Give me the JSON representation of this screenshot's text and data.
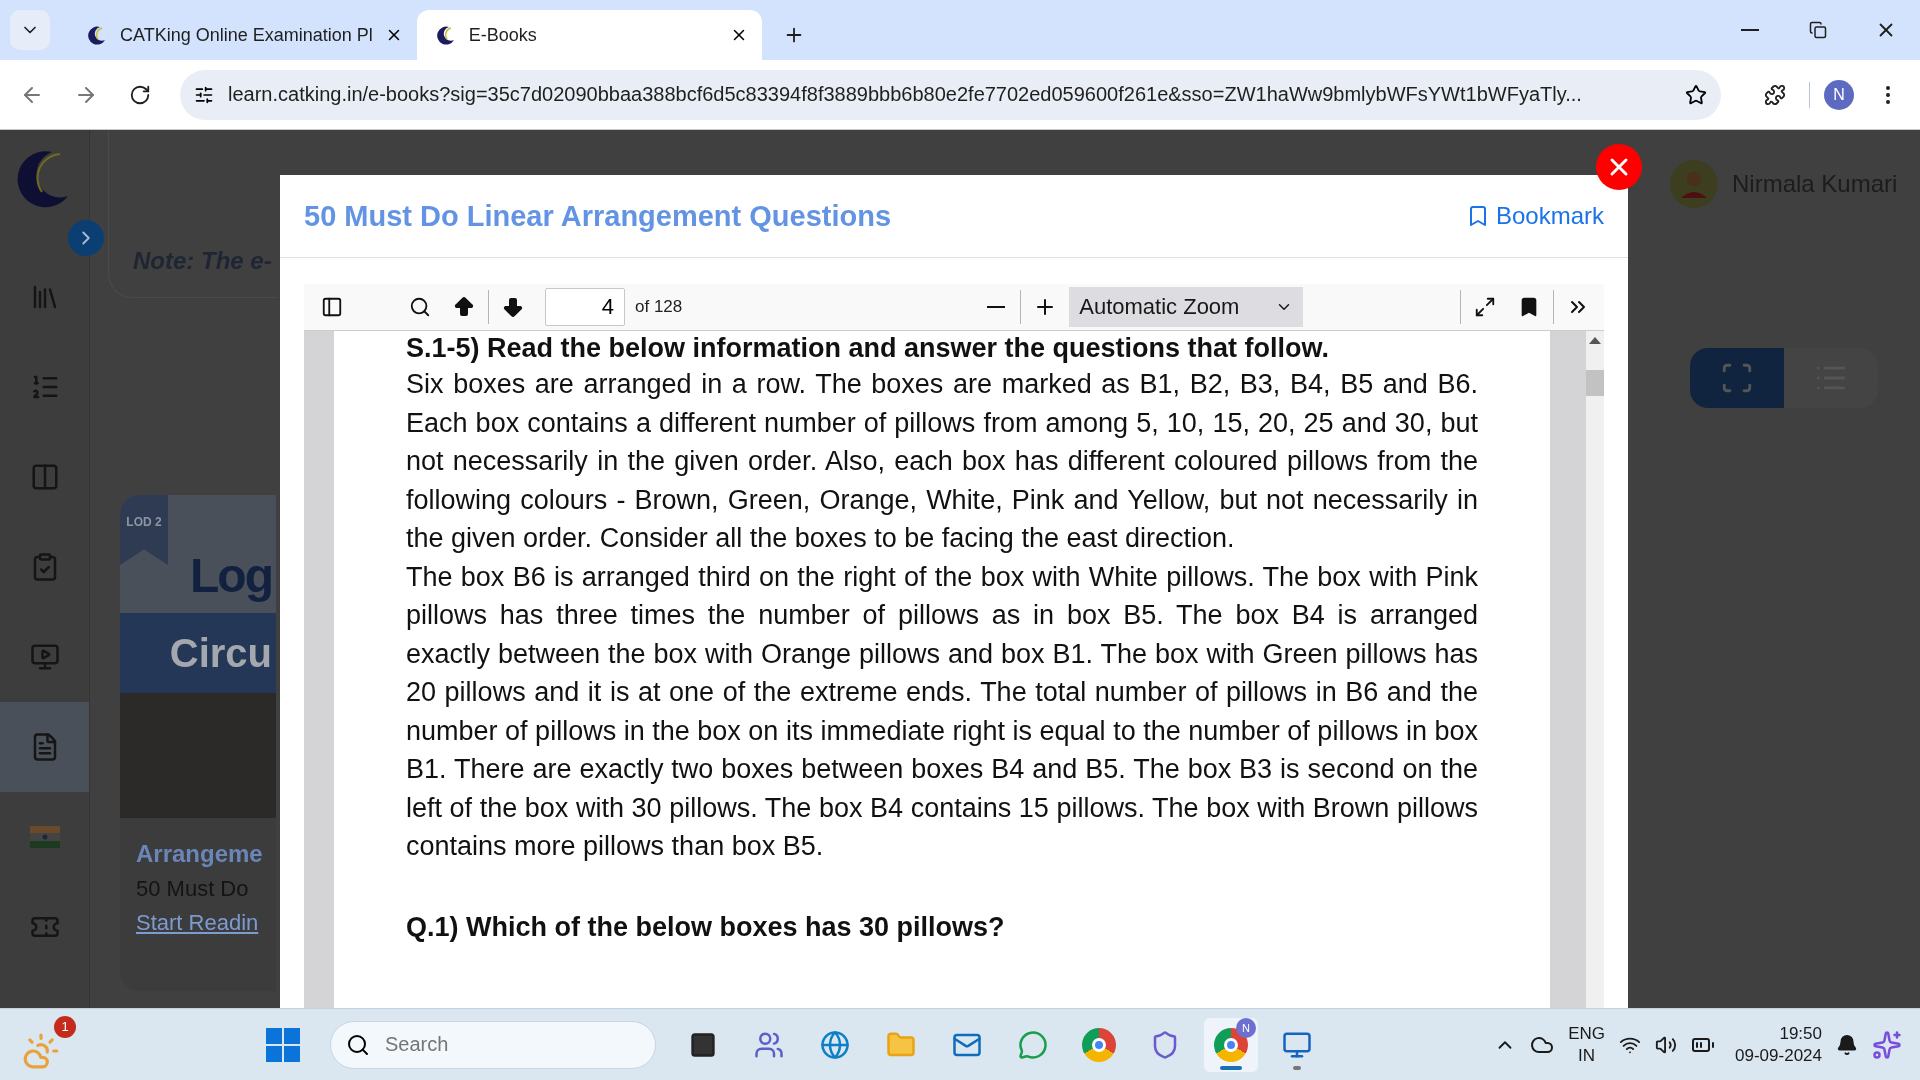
{
  "browser": {
    "tabs": [
      {
        "title": "CATKing Online Examination Pl",
        "selected": false
      },
      {
        "title": "E-Books",
        "selected": true
      }
    ],
    "url": "learn.catking.in/e-books?sig=35c7d02090bbaa388bcf6d5c83394f8f3889bbb6b80e2fe7702ed059600f261e&sso=ZW1haWw9bmlybWFsYWt1bWFyaTly...",
    "profile_initial": "N"
  },
  "page": {
    "sidebar": [
      {
        "selected": false
      },
      {
        "selected": false
      },
      {
        "selected": false
      },
      {
        "selected": false
      },
      {
        "selected": false
      },
      {
        "selected": true
      },
      {
        "selected": false
      },
      {
        "selected": false
      }
    ],
    "note": "Note: The e-",
    "user_name": "Nirmala Kumari",
    "card": {
      "ribbon": "LOD 2",
      "banner_title": "Log",
      "banner_subtitle": "Circu",
      "category": "Arrangeme",
      "title": "50 Must Do",
      "link": "Start Readin"
    }
  },
  "modal": {
    "title": "50 Must Do Linear Arrangement Questions",
    "bookmark": "Bookmark",
    "toolbar": {
      "page_number": "4",
      "page_count": "of 128",
      "zoom": "Automatic Zoom"
    },
    "document": {
      "heading": "S.1-5) Read the below information and answer the questions that follow.",
      "paragraphs": [
        "Six boxes are arranged in a row. The boxes are marked as B1, B2, B3, B4, B5 and B6. Each box contains a different number of pillows from among 5, 10, 15, 20, 25 and 30, but not necessarily in the given order. Also, each box has different coloured pillows from the following colours - Brown, Green, Orange, White, Pink and Yellow, but not necessarily in the given order. Consider all the boxes to be facing the east direction.",
        "The box B6 is arranged third on the right of the box with White pillows. The box with Pink pillows has three times the number of pillows as in box B5. The box B4 is arranged exactly between the box with Orange pillows and box B1. The box with Green pillows has 20 pillows and it is at one of the extreme ends. The total number of pillows in B6 and the number of pillows in the box on its immediate right is equal to the number of pillows in box B1. There are exactly two boxes between boxes B4 and B5. The box B3 is second on the left of the box with 30 pillows. The box B4 contains 15 pillows. The box with Brown pillows contains more pillows than box B5."
      ],
      "question": "Q.1) Which of the below boxes has 30 pillows?"
    }
  },
  "taskbar": {
    "weather_badge": "1",
    "search_placeholder": "Search",
    "apps": [
      {
        "selected": false,
        "running": false
      },
      {
        "selected": false,
        "running": false
      },
      {
        "selected": false,
        "running": false
      },
      {
        "selected": false,
        "running": false
      },
      {
        "selected": false,
        "running": false
      },
      {
        "selected": false,
        "running": false
      },
      {
        "selected": false,
        "running": false
      },
      {
        "selected": false,
        "running": false
      },
      {
        "selected": true,
        "running": true,
        "badge": "N"
      },
      {
        "selected": false,
        "running": true
      }
    ],
    "language": "ENG",
    "region": "IN",
    "time": "19:50",
    "date": "09-09-2024"
  }
}
